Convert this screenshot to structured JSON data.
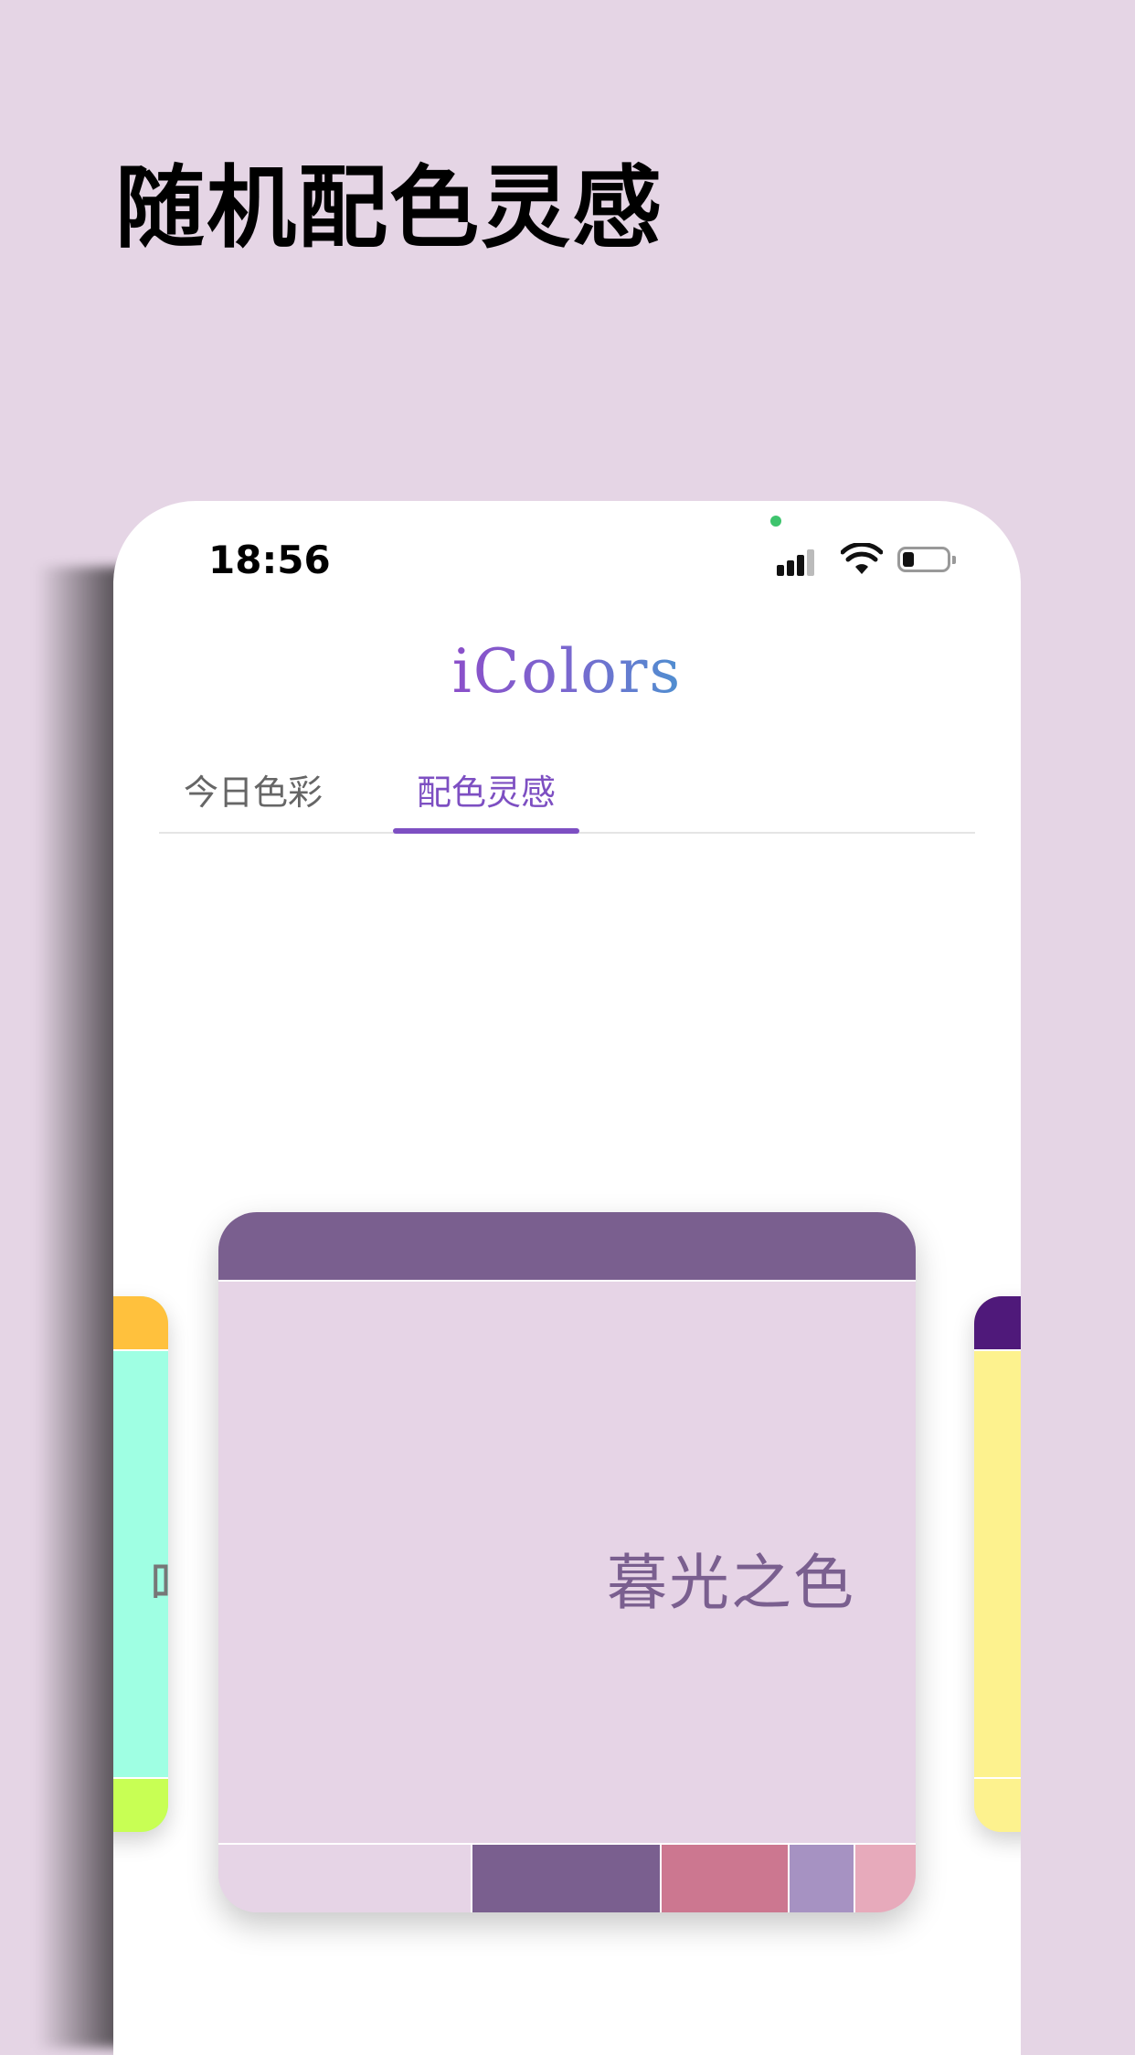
{
  "headline": "随机配色灵感",
  "status_bar": {
    "time": "18:56",
    "icons": [
      "signal-icon",
      "wifi-icon",
      "battery-icon"
    ]
  },
  "app": {
    "logo_text": "iColors"
  },
  "tabs": [
    {
      "label": "今日色彩",
      "active": false
    },
    {
      "label": "配色灵感",
      "active": true
    }
  ],
  "card": {
    "title": "暮光之色",
    "header_color": "#7a5f8f",
    "background_color": "#e6d4e6",
    "palette": [
      "#e6d4e6",
      "#7a5f8f",
      "#cc7790",
      "#a692c2",
      "#e7aabb"
    ]
  },
  "side_cards": {
    "left": {
      "colors": [
        "#ffc13d",
        "#9fffe3",
        "#c8ff54"
      ],
      "partial_title": "味"
    },
    "right": {
      "colors": [
        "#4f197a",
        "#fdf28e"
      ]
    }
  },
  "colors": {
    "background": "#e5d5e5",
    "accent": "#7d4fc2",
    "tab_inactive": "#666666"
  }
}
